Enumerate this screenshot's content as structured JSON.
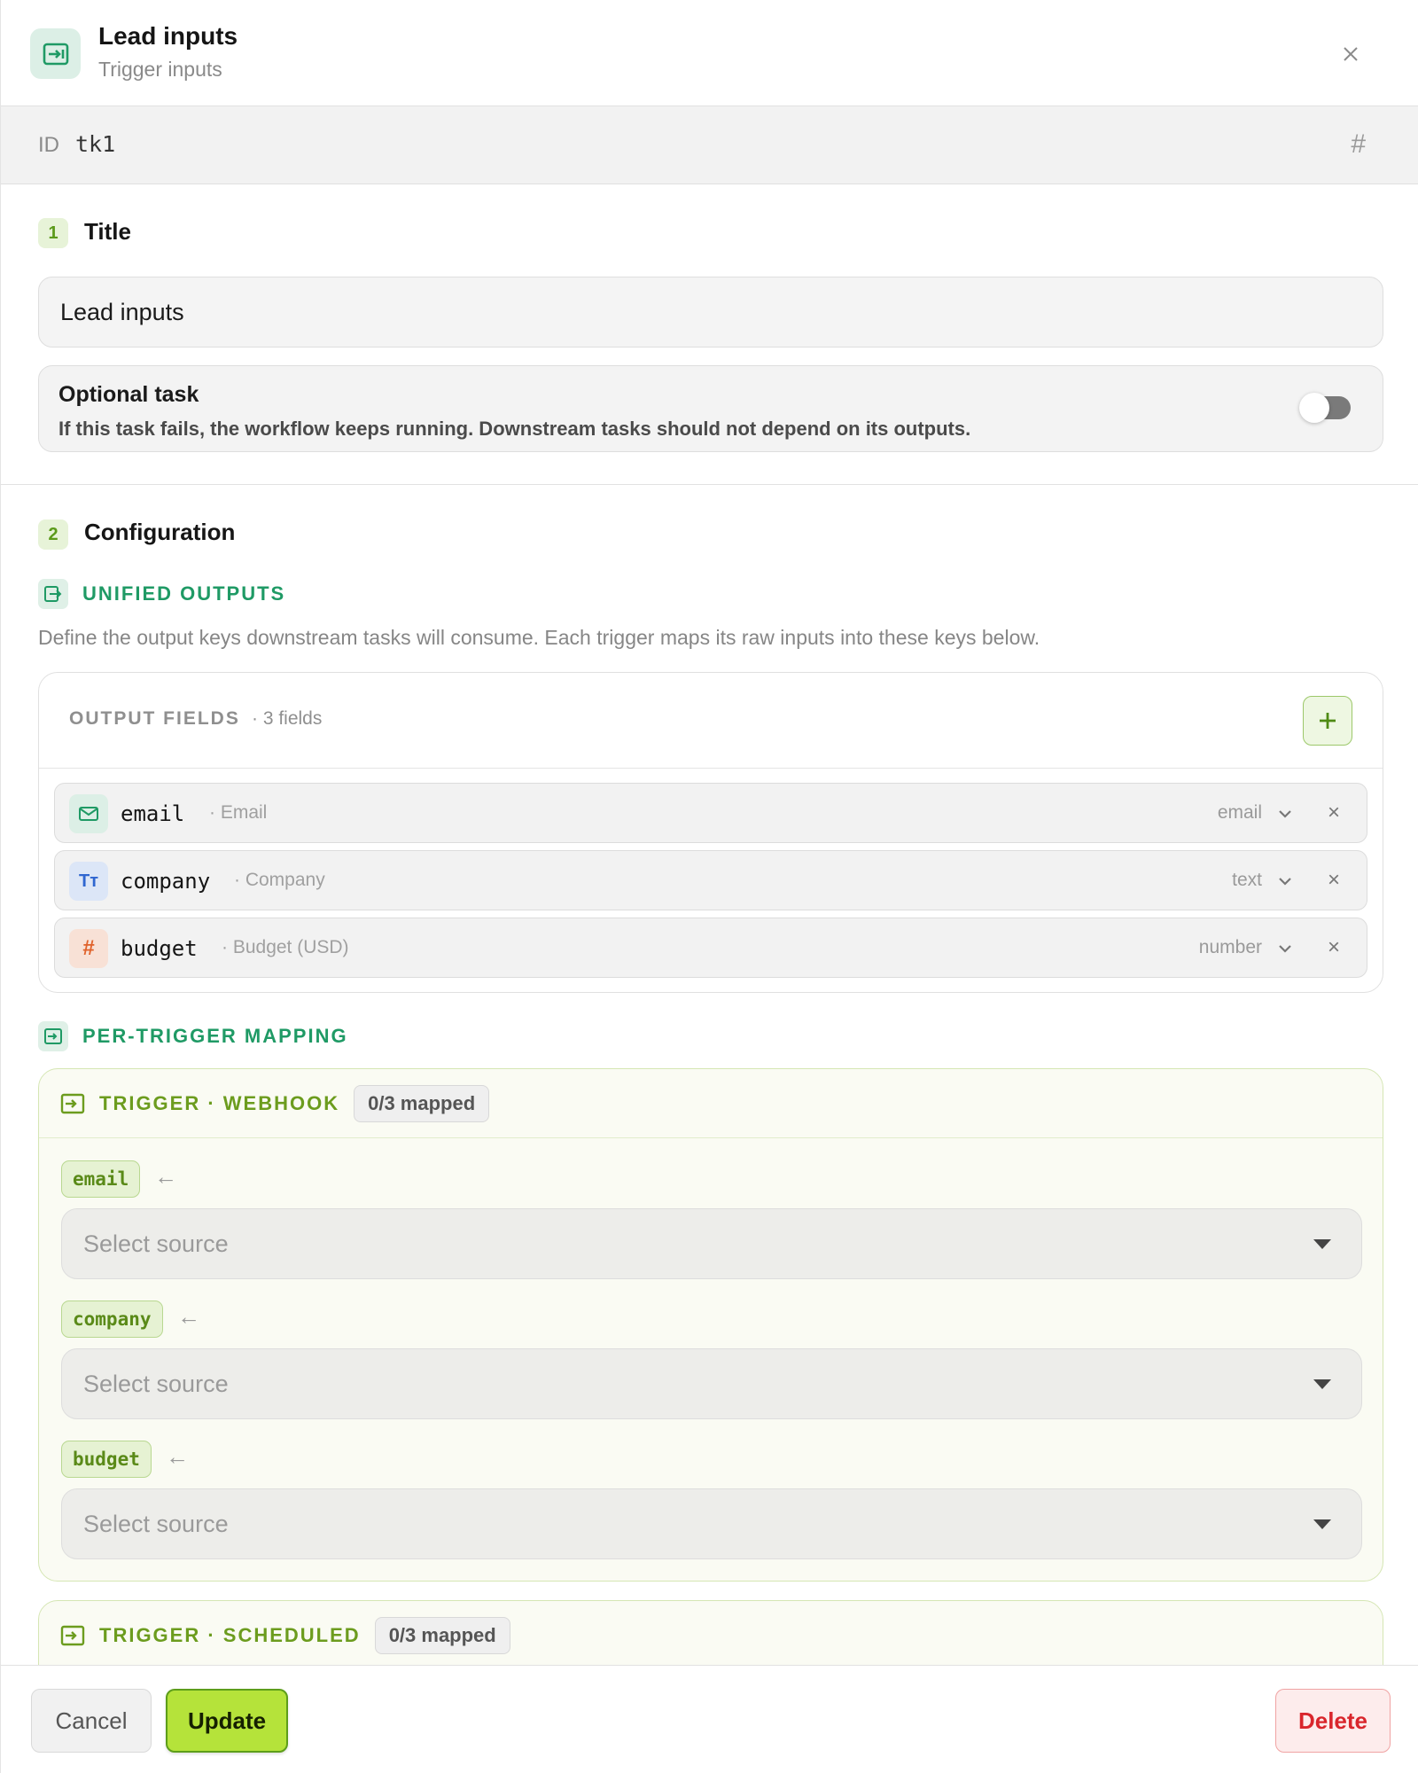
{
  "header": {
    "title": "Lead inputs",
    "subtitle": "Trigger inputs"
  },
  "id_row": {
    "label": "ID",
    "value": "tk1",
    "hash_symbol": "#"
  },
  "section_title": {
    "step": "1",
    "heading": "Title",
    "input_value": "Lead inputs",
    "optional": {
      "title": "Optional task",
      "description": "If this task fails, the workflow keeps running. Downstream tasks should not depend on its outputs.",
      "enabled": false
    }
  },
  "section_config": {
    "step": "2",
    "heading": "Configuration",
    "unified_outputs": {
      "heading": "UNIFIED OUTPUTS",
      "description": "Define the output keys downstream tasks will consume. Each trigger maps its raw inputs into these keys below."
    },
    "output_fields": {
      "heading": "OUTPUT FIELDS",
      "count": "· 3 fields",
      "add_symbol": "+",
      "fields": [
        {
          "key": "email",
          "label": "· Email",
          "type": "email",
          "icon": "mail-icon",
          "icon_glyph": "",
          "remove": "×",
          "icon_bg": "#dcefe6",
          "icon_color": "#1f9a65"
        },
        {
          "key": "company",
          "label": "· Company",
          "type": "text",
          "icon": "text-icon",
          "icon_glyph": "Tт",
          "remove": "×",
          "icon_bg": "#dce6f7",
          "icon_color": "#2f66d0"
        },
        {
          "key": "budget",
          "label": "· Budget (USD)",
          "type": "number",
          "icon": "hash-icon",
          "icon_glyph": "#",
          "remove": "×",
          "icon_bg": "#f8e1d6",
          "icon_color": "#e0622b"
        }
      ]
    },
    "per_trigger_mapping": {
      "heading": "PER-TRIGGER MAPPING",
      "arrow": "←",
      "triggers": [
        {
          "title": "TRIGGER · WEBHOOK",
          "badge": "0/3 mapped",
          "mappings": [
            {
              "key": "email",
              "placeholder": "Select source"
            },
            {
              "key": "company",
              "placeholder": "Select source"
            },
            {
              "key": "budget",
              "placeholder": "Select source"
            }
          ]
        },
        {
          "title": "TRIGGER · SCHEDULED",
          "badge": "0/3 mapped"
        }
      ]
    }
  },
  "footer": {
    "cancel": "Cancel",
    "update": "Update",
    "delete": "Delete"
  },
  "colors": {
    "accent_green": "#1f9a65",
    "lime": "#b5e33a",
    "trigger_green": "#6c9c1e",
    "danger": "#d9262c"
  }
}
